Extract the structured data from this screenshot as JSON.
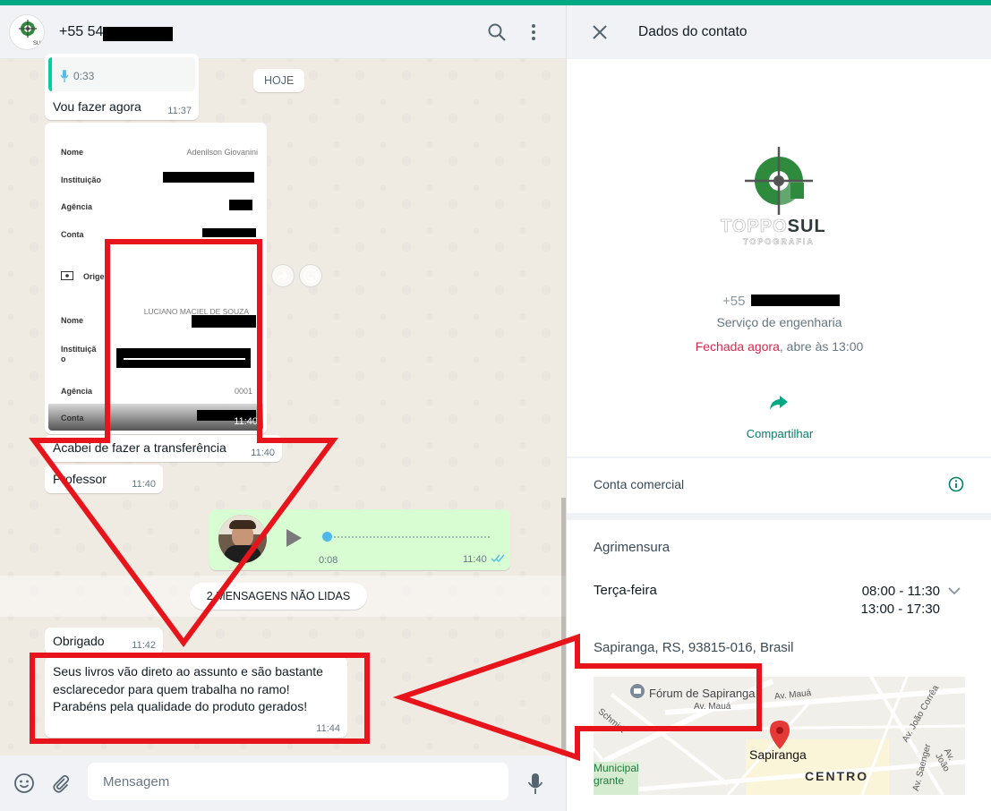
{
  "chat": {
    "header": {
      "contact_name": "+55 54"
    },
    "day_chip": "HOJE",
    "messages": [
      {
        "audio_duration": "0:33",
        "text": "Vou fazer agora",
        "time": "11:37"
      },
      {
        "doc_top": {
          "fields": [
            {
              "label": "Nome",
              "value": "Adenilson Giovanini"
            },
            {
              "label": "Instituição",
              "value": ""
            },
            {
              "label": "Agência",
              "value": ""
            },
            {
              "label": "Conta",
              "value": ""
            }
          ],
          "origin_label": "Orige"
        },
        "doc_bottom": {
          "name_value": "LUCIANO MACIEL DE SOUZA",
          "fields": [
            {
              "label": "Nome"
            },
            {
              "label": "Instituiçã\no"
            },
            {
              "label": "Agência",
              "value": "0001"
            },
            {
              "label": "Conta"
            }
          ]
        },
        "time": "11:40"
      },
      {
        "text": "Acabei de fazer a transferência",
        "time": "11:40"
      },
      {
        "text": "Professor",
        "time": "11:40"
      },
      {
        "type": "audio_out",
        "position": "0:08",
        "time": "11:40"
      },
      {
        "text": "Obrigado",
        "time": "11:42"
      },
      {
        "text_lines": [
          "Seus livros vão direto ao assunto e são bastante",
          "esclarecedor para quem trabalha no ramo!",
          "Parabéns pela qualidade do produto gerados!"
        ],
        "time": "11:44"
      }
    ],
    "unread_label": "2 MENSAGENS NÃO LIDAS",
    "input_placeholder": "Mensagem"
  },
  "contact": {
    "title": "Dados do contato",
    "logo": {
      "brand_light": "TOPPO",
      "brand_dark": "SUL",
      "tagline": "TOPOGRAFIA"
    },
    "phone_prefix": "+55",
    "category": "Serviço de engenharia",
    "status_closed": "Fechada agora",
    "status_rest": ", abre às 13:00",
    "share_label": "Compartilhar",
    "business_label": "Conta comercial",
    "category2": "Agrimensura",
    "day": "Terça-feira",
    "hours": [
      "08:00 - 11:30",
      "13:00 - 17:30"
    ],
    "address": "Sapiranga, RS, 93815-016, Brasil",
    "map": {
      "forum": "Fórum de Sapiranga",
      "av_maua_1": "Av. Mauá",
      "av_maua_2": "Av. Mauá",
      "schmidt": "Schmidt",
      "av_joao_correa": "Av. João Corrêa",
      "av_saenger": "Av. Saenger",
      "av_joao_2": "Av. João",
      "city": "Sapiranga",
      "centro": "CENTRO",
      "municipal_1": "Municipal",
      "municipal_2": "grante"
    }
  },
  "colors": {
    "accent": "#00a884",
    "green_dark": "#008069",
    "outgoing_bubble": "#d9fdd3",
    "annotation_red": "#e8141c",
    "closed_red": "#d6284c"
  }
}
